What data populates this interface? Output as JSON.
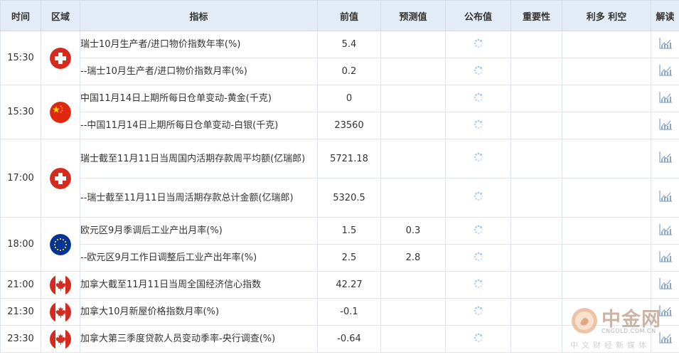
{
  "columns": {
    "time": "时间",
    "region": "区域",
    "indicator": "指标",
    "previous": "前值",
    "forecast": "预测值",
    "actual": "公布值",
    "importance": "重要性",
    "effect": "利多 利空",
    "analysis": "解读"
  },
  "groups": [
    {
      "time": "15:30",
      "country": "switzerland",
      "rows": [
        {
          "indicator": "瑞士10月生产者/进口物价指数年率(%)",
          "previous": "5.4",
          "forecast": ""
        },
        {
          "indicator": "--瑞士10月生产者/进口物价指数月率(%)",
          "previous": "0.2",
          "forecast": ""
        }
      ]
    },
    {
      "time": "15:30",
      "country": "china",
      "rows": [
        {
          "indicator": "中国11月14日上期所每日仓单变动-黄金(千克)",
          "previous": "0",
          "forecast": ""
        },
        {
          "indicator": "--中国11月14日上期所每日仓单变动-白银(千克)",
          "previous": "23560",
          "forecast": ""
        }
      ]
    },
    {
      "time": "17:00",
      "country": "switzerland",
      "rows": [
        {
          "indicator": "瑞士截至11月11日当周国内活期存款周平均额(亿瑞郎)",
          "previous": "5721.18",
          "forecast": ""
        },
        {
          "indicator": "--瑞士截至11月11日当周活期存款总计金额(亿瑞郎)",
          "previous": "5320.5",
          "forecast": ""
        }
      ]
    },
    {
      "time": "18:00",
      "country": "eurozone",
      "rows": [
        {
          "indicator": "欧元区9月季调后工业产出月率(%)",
          "previous": "1.5",
          "forecast": "0.3"
        },
        {
          "indicator": "--欧元区9月工作日调整后工业产出年率(%)",
          "previous": "2.5",
          "forecast": "2.8"
        }
      ]
    },
    {
      "time": "21:00",
      "country": "canada",
      "rows": [
        {
          "indicator": "加拿大截至11月11日当周全国经济信心指数",
          "previous": "42.27",
          "forecast": ""
        }
      ]
    },
    {
      "time": "21:30",
      "country": "canada",
      "rows": [
        {
          "indicator": "加拿大10月新屋价格指数月率(%)",
          "previous": "-0.1",
          "forecast": ""
        }
      ]
    },
    {
      "time": "23:30",
      "country": "canada",
      "rows": [
        {
          "indicator": "加拿大第三季度贷款人员变动季率-央行调查(%)",
          "previous": "-0.64",
          "forecast": ""
        }
      ]
    }
  ],
  "watermark": {
    "name": "中金网",
    "url": "CNGOLD.COM.CN",
    "tagline": "中文财经新媒体"
  },
  "colors": {
    "header_bg": "#e3ecf6",
    "border": "#dfe5ec",
    "chart_icon": "#8aa7c8",
    "spinner": "#9cc3e6"
  }
}
